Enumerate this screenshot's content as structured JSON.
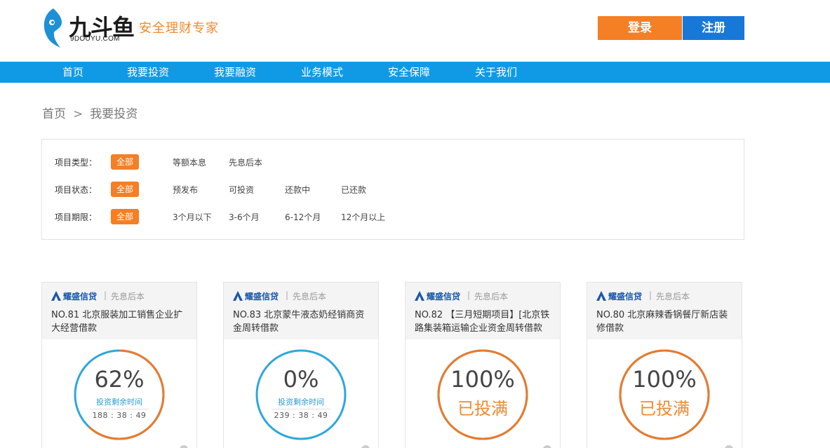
{
  "header": {
    "logo_text": "九斗鱼",
    "logo_domain": "9DOUYU.COM",
    "slogan": "安全理财专家",
    "login_label": "登录",
    "register_label": "注册"
  },
  "nav": [
    "首页",
    "我要投资",
    "我要融资",
    "业务模式",
    "安全保障",
    "关于我们"
  ],
  "breadcrumb": {
    "home": "首页",
    "separator": ">",
    "current": "我要投资"
  },
  "filters": [
    {
      "label": "项目类型：",
      "selected": "全部",
      "options": [
        "等额本息",
        "先息后本"
      ]
    },
    {
      "label": "项目状态：",
      "selected": "全部",
      "options": [
        "预发布",
        "可投资",
        "还款中",
        "已还款"
      ]
    },
    {
      "label": "项目期限：",
      "selected": "全部",
      "options": [
        "3个月以下",
        "3-6个月",
        "6-12个月",
        "12个月以上"
      ]
    }
  ],
  "cards": [
    {
      "brand": "耀盛信贷",
      "divider": "|",
      "type": "先息后本",
      "title": "NO.81 北京服装加工销售企业扩大经营借款",
      "percent": "62%",
      "progress": 0.62,
      "sub": "投资剩余时间",
      "time": "188 : 38 : 49",
      "full_label": ""
    },
    {
      "brand": "耀盛信贷",
      "divider": "|",
      "type": "先息后本",
      "title": "NO.83 北京蒙牛液态奶经销商资金周转借款",
      "percent": "0%",
      "progress": 0,
      "sub": "投资剩余时间",
      "time": "239 : 38 : 49",
      "full_label": ""
    },
    {
      "brand": "耀盛信贷",
      "divider": "|",
      "type": "先息后本",
      "title": "NO.82 【三月短期项目】[北京铁路集装箱运输企业资金周转借款",
      "percent": "100%",
      "progress": 1,
      "sub": "",
      "time": "",
      "full_label": "已投满"
    },
    {
      "brand": "耀盛信贷",
      "divider": "|",
      "type": "先息后本",
      "title": "NO.80 北京麻辣香锅餐厅新店装修借款",
      "percent": "100%",
      "progress": 1,
      "sub": "",
      "time": "",
      "full_label": "已投满"
    }
  ],
  "colors": {
    "orange": "#f57f24",
    "blue": "#1878d8",
    "nav_blue": "#109ae6",
    "ring_blue": "#2ea7dd",
    "ring_orange": "#ea7a2a"
  }
}
